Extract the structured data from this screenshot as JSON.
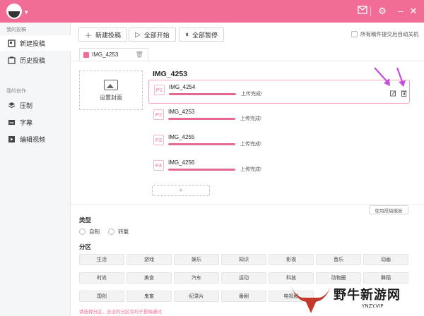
{
  "sidebar": {
    "group_my_posts": "我的投稿",
    "group_my_creation": "我的创作",
    "items": [
      {
        "label": "新建投稿",
        "icon": "new-post-icon",
        "active": true
      },
      {
        "label": "历史投稿",
        "icon": "history-icon",
        "active": false
      },
      {
        "label": "压制",
        "icon": "compress-icon",
        "active": false
      },
      {
        "label": "字幕",
        "icon": "subtitle-icon",
        "active": false
      },
      {
        "label": "编辑视频",
        "icon": "edit-video-icon",
        "active": false
      }
    ]
  },
  "toolbar": {
    "new_post": "新建投稿",
    "start_all": "全部开始",
    "pause_all": "全部暂停",
    "auto_shutdown": "所有稿件提交后自动关机"
  },
  "draft": {
    "tab_name": "IMG_4253",
    "title": "IMG_4253",
    "cover_label": "设置封面"
  },
  "parts": [
    {
      "no": "P1",
      "name": "IMG_4254",
      "status": "上传完成!",
      "progress": 1.0
    },
    {
      "no": "P2",
      "name": "IMG_4253",
      "status": "上传完成!",
      "progress": 1.0
    },
    {
      "no": "P3",
      "name": "IMG_4255",
      "status": "上传完成!",
      "progress": 1.0
    },
    {
      "no": "P4",
      "name": "IMG_4256",
      "status": "上传完成!",
      "progress": 1.0
    }
  ],
  "add_part_symbol": "+",
  "use_template": "使用投稿模板",
  "type_section": {
    "title": "类型",
    "options": [
      "自制",
      "转载"
    ]
  },
  "zone_section": {
    "title": "分区",
    "categories": [
      "生活",
      "游戏",
      "娱乐",
      "知识",
      "影视",
      "音乐",
      "动画",
      "时尚",
      "美食",
      "汽车",
      "运动",
      "科技",
      "动物圈",
      "舞蹈",
      "国创",
      "鬼畜",
      "纪录片",
      "番剧",
      "电视剧",
      "电影",
      ""
    ],
    "hint": "请选择分区，合适的分区有利于投稿通过"
  },
  "watermark": {
    "text": "野牛新游网",
    "sub": "YNZY.VIP"
  },
  "colors": {
    "brand": "#f26d95",
    "arrow": "#c44de0"
  }
}
